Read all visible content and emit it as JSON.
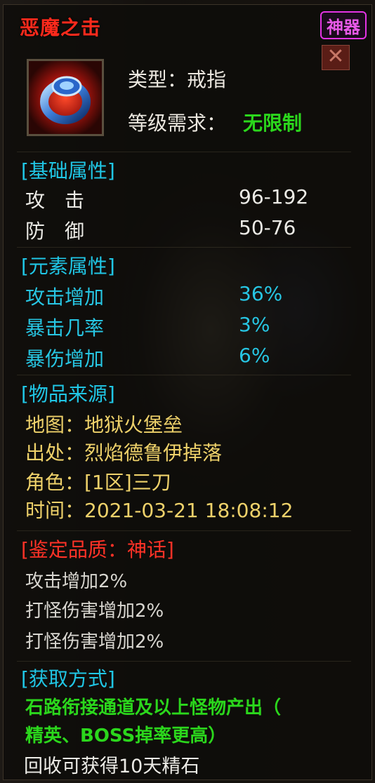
{
  "item": {
    "name": "恶魔之击",
    "badge": "神器",
    "close_glyph": "✕",
    "icon": "ring-icon",
    "type_line": "类型：戒指",
    "level_label": "等级需求：",
    "level_value": "无限制"
  },
  "base_attributes": {
    "header": "[基础属性]",
    "rows": [
      {
        "label": "攻　击",
        "value": "96-192"
      },
      {
        "label": "防　御",
        "value": "50-76"
      }
    ]
  },
  "element_attributes": {
    "header": "[元素属性]",
    "rows": [
      {
        "label": "攻击增加",
        "value": "36%"
      },
      {
        "label": "暴击几率",
        "value": "3%"
      },
      {
        "label": "暴伤增加",
        "value": "6%"
      }
    ]
  },
  "source": {
    "header": "[物品来源]",
    "map": "地图：地狱火堡垒",
    "origin": "出处：烈焰德鲁伊掉落",
    "role": "角色：[1区]三刀",
    "time": "时间：2021-03-21  18:08:12"
  },
  "quality": {
    "header": "[鉴定品质：神话]",
    "lines": [
      "攻击增加2%",
      "打怪伤害增加2%",
      "打怪伤害增加2%"
    ]
  },
  "acquire": {
    "header": "[获取方式]",
    "line1": "石路衔接通道及以上怪物产出（",
    "line2": "精英、BOSS掉率更高）",
    "recycle": "回收可获得10天精石"
  },
  "colors": {
    "title": "#ff2a1c",
    "badge": "#e433e4",
    "section": "#20c6e5",
    "green": "#2bd71c",
    "yellow": "#eed16a",
    "quality_red": "#ff3227"
  }
}
